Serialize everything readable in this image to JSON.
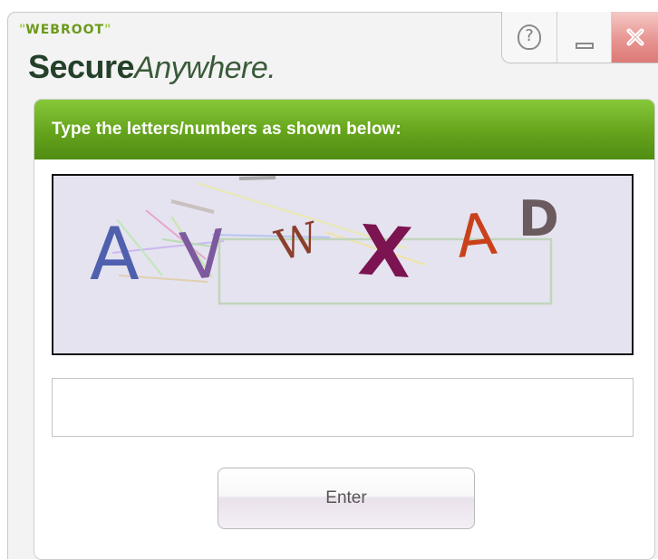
{
  "brand": {
    "top_text": "WEBROOT",
    "name_bold": "Secure",
    "name_light": "Anywhere."
  },
  "window_controls": {
    "help_glyph": "?",
    "help_icon": "help-icon",
    "minimize_icon": "minimize-icon",
    "close_icon": "close-icon"
  },
  "prompt": "Type the letters/numbers as shown below:",
  "captcha": {
    "letters": [
      "A",
      "V",
      "W",
      "X",
      "A",
      "D"
    ],
    "letter_colors": [
      "#4f60ae",
      "#7d5a9e",
      "#8a3f2c",
      "#7c1452",
      "#c9411a",
      "#6b5a5e"
    ],
    "background": "#e5e3ef"
  },
  "answer": {
    "value": "",
    "placeholder": ""
  },
  "enter_label": "Enter",
  "colors": {
    "header_green": "#68a61e",
    "close_red": "#e79592",
    "brand_dark": "#24402a"
  }
}
